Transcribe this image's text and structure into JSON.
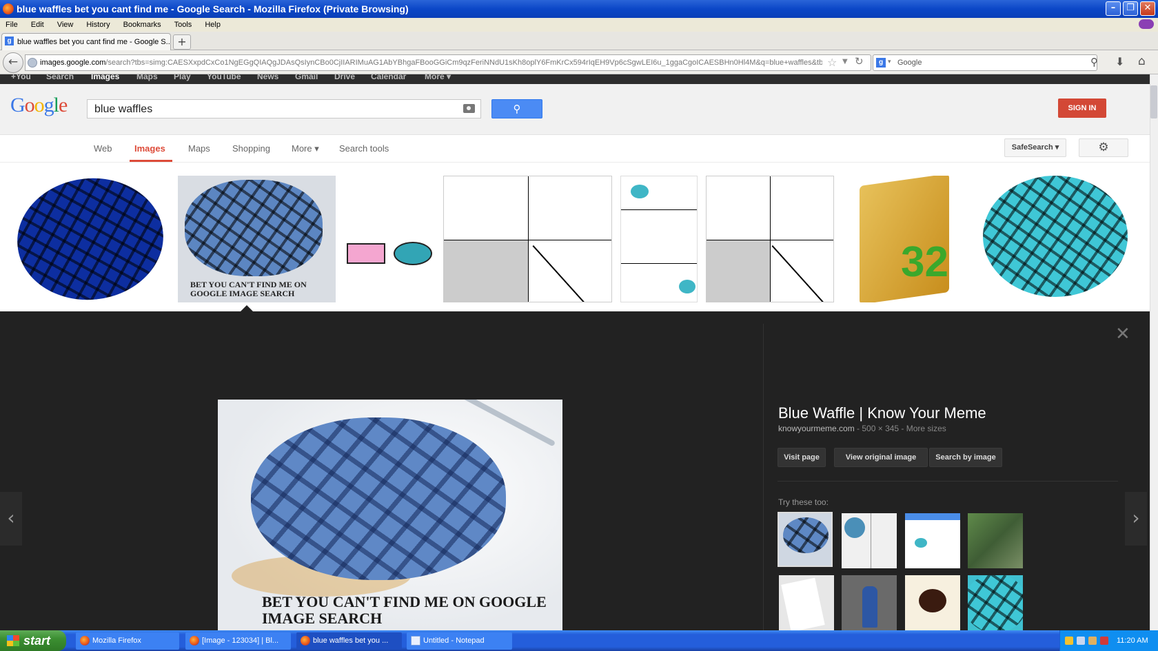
{
  "window": {
    "title": "blue waffles bet you cant find me - Google Search - Mozilla Firefox (Private Browsing)"
  },
  "menu": [
    "File",
    "Edit",
    "View",
    "History",
    "Bookmarks",
    "Tools",
    "Help"
  ],
  "tab": {
    "label": "blue waffles bet you cant find me - Google S...",
    "new_tab": "+"
  },
  "nav": {
    "url_domain": "images.google.com",
    "url_rest": "/search?tbs=simg:CAESXxpdCxCo1NgEGgQIAQgJDAsQsIynCBo0CjIIARIMuAG1AbYBhgaFBooGGiCm9qzFeriNNdU1sKh8oplY6FmKrCx594rIqEH9Vp6cSgwLEI6u_1ggaCgoICAESBHn0Hl4M&q=blue+waffles&tbm=isch&sa=",
    "search_engine_placeholder": "Google"
  },
  "gbar": [
    "+You",
    "Search",
    "Images",
    "Maps",
    "Play",
    "YouTube",
    "News",
    "Gmail",
    "Drive",
    "Calendar",
    "More ▾"
  ],
  "google": {
    "logo": [
      "G",
      "o",
      "o",
      "g",
      "l",
      "e"
    ],
    "logo_colors": [
      "#3b78e7",
      "#dd4b39",
      "#f4b400",
      "#3b78e7",
      "#0f9d58",
      "#dd4b39"
    ],
    "query": "blue waffles",
    "signin": "SIGN IN",
    "tabs": [
      "Web",
      "Images",
      "Maps",
      "Shopping",
      "More ▾",
      "Search tools"
    ],
    "safesearch": "SafeSearch ▾"
  },
  "thumbs": {
    "caption2": "BET YOU CAN'T FIND ME ON GOOGLE IMAGE SEARCH",
    "folder_number": "32"
  },
  "detail": {
    "title": "Blue Waffle | Know Your Meme",
    "site": "knowyourmeme.com",
    "meta": " - 500 × 345 - More sizes",
    "image_caption": "BET YOU CAN'T FIND ME ON GOOGLE IMAGE SEARCH",
    "buttons": {
      "visit": "Visit page",
      "original": "View original image",
      "search_by_image": "Search by image"
    },
    "try_these": "Try these too:"
  },
  "taskbar": {
    "start": "start",
    "tasks": [
      "Mozilla Firefox",
      "[Image - 123034] | Bl...",
      "blue waffles bet you ...",
      "Untitled - Notepad"
    ],
    "time": "11:20 AM"
  }
}
